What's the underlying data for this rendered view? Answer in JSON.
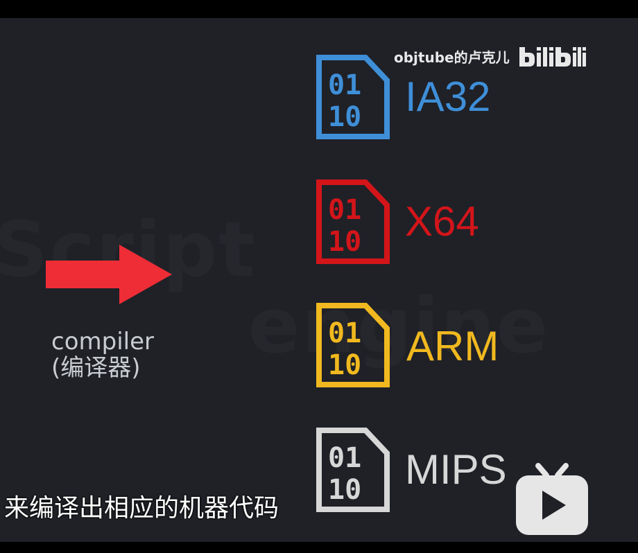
{
  "background_words": {
    "script": "Script",
    "engine": "engine"
  },
  "watermark": {
    "channel": "objtube的卢克儿",
    "brand": "bilibili"
  },
  "compiler": {
    "line1": "compiler",
    "line2": "(编译器)"
  },
  "architectures": [
    {
      "label": "IA32",
      "color": "#3f8fd8",
      "file_bits_top": "01",
      "file_bits_bottom": "10"
    },
    {
      "label": "X64",
      "color": "#d3151a",
      "file_bits_top": "01",
      "file_bits_bottom": "10"
    },
    {
      "label": "ARM",
      "color": "#f1b91f",
      "file_bits_top": "01",
      "file_bits_bottom": "10"
    },
    {
      "label": "MIPS",
      "color": "#d7d7d7",
      "file_bits_top": "01",
      "file_bits_bottom": "10"
    }
  ],
  "subtitle": "来编译出相应的机器代码",
  "colors": {
    "arrow": "#ee2d36",
    "frame": "#1f2127",
    "compiler_text": "#c9ccd1"
  }
}
